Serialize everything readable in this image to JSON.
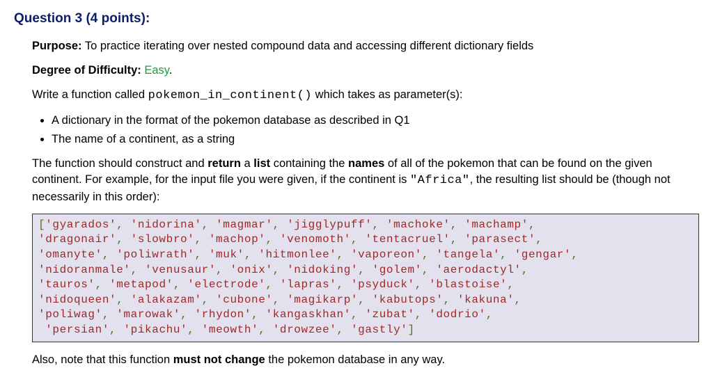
{
  "title": "Question 3 (4 points):",
  "purpose": {
    "label": "Purpose:",
    "text": "To practice iterating over nested compound data and accessing different dictionary fields"
  },
  "difficulty": {
    "label": "Degree of Difficulty:",
    "level": "Easy",
    "period": "."
  },
  "intro": {
    "before_code": "Write a function called ",
    "func": "pokemon_in_continent()",
    "after_code": " which takes as parameter(s):"
  },
  "bullets": [
    "A dictionary in the format of the pokemon database as described in Q1",
    "The name of a continent, as a string"
  ],
  "desc": {
    "p1a": "The function should construct and ",
    "return": "return",
    "p1b": " a ",
    "list": "list",
    "p1c": " containing the ",
    "names": "names",
    "p1d": " of all of the pokemon that can be found on the given continent. For example, for the input file you were given, if the continent is ",
    "africa": "\"Africa\"",
    "p1e": ", the resulting list should be (though not necessarily in this order):"
  },
  "chart_data": {
    "type": "table",
    "title": "Example return list for continent Africa",
    "values": [
      "gyarados",
      "nidorina",
      "magmar",
      "jigglypuff",
      "machoke",
      "machamp",
      "dragonair",
      "slowbro",
      "machop",
      "venomoth",
      "tentacruel",
      "parasect",
      "omanyte",
      "poliwrath",
      "muk",
      "hitmonlee",
      "vaporeon",
      "tangela",
      "gengar",
      "nidoranmale",
      "venusaur",
      "onix",
      "nidoking",
      "golem",
      "aerodactyl",
      "tauros",
      "metapod",
      "electrode",
      "lapras",
      "psyduck",
      "blastoise",
      "nidoqueen",
      "alakazam",
      "cubone",
      "magikarp",
      "kabutops",
      "kakuna",
      "poliwag",
      "marowak",
      "rhydon",
      "kangaskhan",
      "zubat",
      "dodrio",
      "persian",
      "pikachu",
      "meowth",
      "drowzee",
      "gastly"
    ],
    "line_breaks_after_index": [
      5,
      11,
      18,
      24,
      30,
      36,
      42
    ],
    "indent_last_line": true
  },
  "note": {
    "prefix": "Also, note that this function ",
    "strong": "must not change",
    "suffix": " the pokemon database in any way."
  }
}
